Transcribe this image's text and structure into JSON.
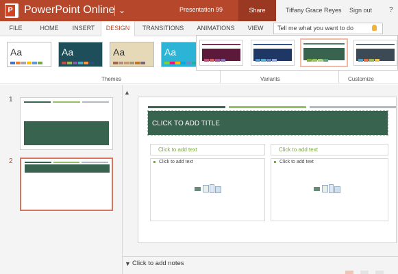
{
  "app": {
    "name": "PowerPoint Online",
    "document_name": "Presentation 99"
  },
  "header": {
    "share_label": "Share",
    "user_name": "Tiffany Grace Reyes",
    "sign_out_label": "Sign out",
    "help_label": "?"
  },
  "tabs": [
    {
      "label": "FILE",
      "active": false
    },
    {
      "label": "HOME",
      "active": false
    },
    {
      "label": "INSERT",
      "active": false
    },
    {
      "label": "DESIGN",
      "active": true
    },
    {
      "label": "TRANSITIONS",
      "active": false
    },
    {
      "label": "ANIMATIONS",
      "active": false
    },
    {
      "label": "VIEW",
      "active": false
    }
  ],
  "tell_me": {
    "placeholder": "Tell me what you want to do"
  },
  "ribbon": {
    "groups": {
      "themes": "Themes",
      "variants": "Variants",
      "customize": "Customize"
    },
    "themes": [
      {
        "label": "Aa",
        "bg": "#ffffff",
        "fg": "#333333",
        "swatches": [
          "#4472c4",
          "#ed7d31",
          "#a5a5a5",
          "#ffc000",
          "#5b9bd5",
          "#70ad47"
        ]
      },
      {
        "label": "Aa",
        "bg": "#1d4e5a",
        "fg": "#ffffff",
        "swatches": [
          "#c0504d",
          "#9bbb59",
          "#8064a2",
          "#4bacc6",
          "#f79646",
          "#2c4d75"
        ]
      },
      {
        "label": "Aa",
        "bg": "#e6d9b8",
        "fg": "#333333",
        "swatches": [
          "#a5644e",
          "#b58b80",
          "#c3986d",
          "#a19574",
          "#c17529",
          "#826276"
        ]
      },
      {
        "label": "Aa",
        "bg": "#2bb4d6",
        "fg": "#ffffff",
        "swatches": [
          "#7fd13b",
          "#ea157a",
          "#feb80a",
          "#00addc",
          "#738ac8",
          "#1ab39f"
        ]
      }
    ],
    "variants": [
      {
        "band": "#5b1a3a",
        "line": "#7a3356",
        "swatches": [
          "#c05080",
          "#d06060",
          "#a05090",
          "#8a6fb0"
        ]
      },
      {
        "band": "#1f3764",
        "line": "#34558a",
        "swatches": [
          "#4a8fd0",
          "#50b0d0",
          "#6080c0",
          "#90a8d8"
        ]
      },
      {
        "band": "#38644f",
        "line": "#4e7c66",
        "swatches": [
          "#7cab3c",
          "#92c060",
          "#a8cc80",
          "#5d9d78"
        ]
      },
      {
        "band": "#3b4a55",
        "line": "#55646f",
        "swatches": [
          "#4ea0c8",
          "#e07040",
          "#a0b850",
          "#f0c050"
        ]
      }
    ]
  },
  "slides_pane": {
    "slides": [
      {
        "number": "1"
      },
      {
        "number": "2",
        "selected": true
      }
    ]
  },
  "slide": {
    "title_placeholder": "CLICK TO ADD TITLE",
    "left_header_placeholder": "Click to add text",
    "right_header_placeholder": "Click to add text",
    "left_content_placeholder": "Click to add text",
    "right_content_placeholder": "Click to add text",
    "accent_colors": [
      "#38644f",
      "#92c060",
      "#b0b8c0"
    ]
  },
  "notes": {
    "placeholder": "Click to add notes"
  },
  "colors": {
    "brand": "#b7472a",
    "theme_green": "#38644f",
    "accent_green": "#7cab3c"
  }
}
